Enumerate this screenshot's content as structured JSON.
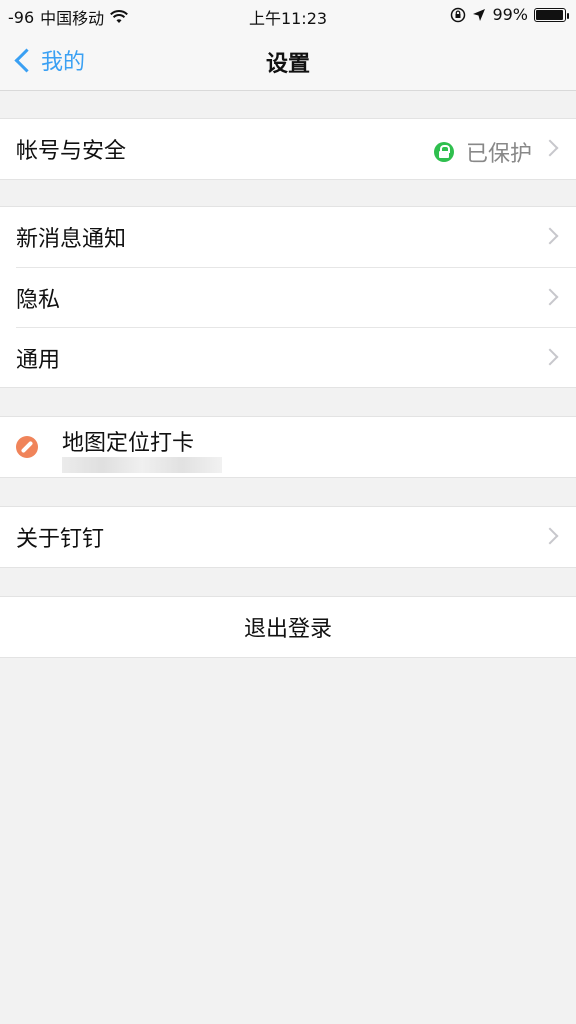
{
  "status_bar": {
    "signal": "-96",
    "carrier": "中国移动",
    "time": "上午11:23",
    "battery": "99%",
    "icons": [
      "wifi-icon",
      "orientation-lock-icon",
      "location-arrow-icon",
      "battery-icon"
    ]
  },
  "nav": {
    "back_label": "我的",
    "title": "设置"
  },
  "account": {
    "label": "帐号与安全",
    "status": "已保护"
  },
  "settings_items": [
    {
      "label": "新消息通知"
    },
    {
      "label": "隐私"
    },
    {
      "label": "通用"
    }
  ],
  "map_checkin": {
    "label": "地图定位打卡"
  },
  "about": {
    "label": "关于钉钉"
  },
  "logout": {
    "label": "退出登录"
  },
  "colors": {
    "accent": "#3aa0f3",
    "protected_green": "#2fbf4e",
    "map_icon": "#f0845a",
    "background": "#f2f2f2"
  }
}
